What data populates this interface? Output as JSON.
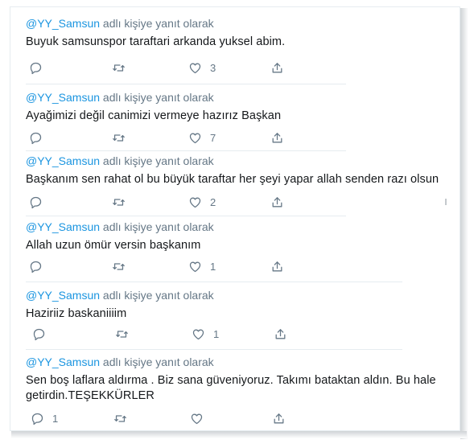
{
  "colors": {
    "handle": "#1b95e0",
    "muted": "#657786",
    "text": "#14171a",
    "divider": "#e6ecf0"
  },
  "icons": {
    "reply": "reply-icon",
    "retweet": "retweet-icon",
    "like": "heart-icon",
    "share": "share-icon"
  },
  "tweets": [
    {
      "handle": "@YY_Samsun",
      "reply_suffix": " adlı kişiye yanıt olarak",
      "text": "Buyuk samsunspor taraftari arkanda yuksel abim.",
      "reply_count": "",
      "retweet_count": "",
      "like_count": "3"
    },
    {
      "handle": "@YY_Samsun",
      "reply_suffix": " adlı kişiye yanıt olarak",
      "text": "Ayağimizi değil canimizi vermeye hazırız Başkan",
      "reply_count": "",
      "retweet_count": "",
      "like_count": "7"
    },
    {
      "handle": "@YY_Samsun",
      "reply_suffix": " adlı kişiye yanıt olarak",
      "text": "Başkanım sen rahat ol bu büyük taraftar her şeyi yapar allah senden razı olsun",
      "reply_count": "",
      "retweet_count": "",
      "like_count": "2"
    },
    {
      "handle": "@YY_Samsun",
      "reply_suffix": " adlı kişiye yanıt olarak",
      "text": "Allah uzun ömür versin başkanım",
      "reply_count": "",
      "retweet_count": "",
      "like_count": "1"
    },
    {
      "handle": "@YY_Samsun",
      "reply_suffix": " adlı kişiye yanıt olarak",
      "text": "Haziriiz baskaniiiim",
      "reply_count": "",
      "retweet_count": "",
      "like_count": "1"
    },
    {
      "handle": "@YY_Samsun",
      "reply_suffix": " adlı kişiye yanıt olarak",
      "text_line1": "Sen boş laflara aldırma . Biz sana güveniyoruz. Takımı bataktan aldın. Bu hale",
      "text_line2": "getirdin.TEŞEKKÜRLER",
      "reply_count": "1",
      "retweet_count": "",
      "like_count": ""
    }
  ]
}
